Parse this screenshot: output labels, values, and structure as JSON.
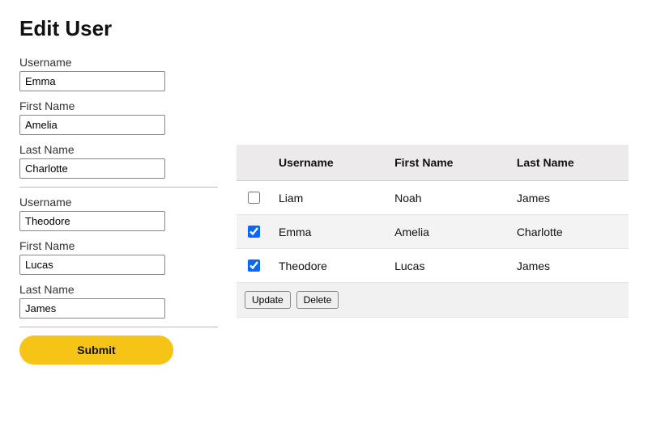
{
  "title": "Edit User",
  "form": {
    "entries": [
      {
        "username_label": "Username",
        "username_value": "Emma",
        "firstname_label": "First Name",
        "firstname_value": "Amelia",
        "lastname_label": "Last Name",
        "lastname_value": "Charlotte"
      },
      {
        "username_label": "Username",
        "username_value": "Theodore",
        "firstname_label": "First Name",
        "firstname_value": "Lucas",
        "lastname_label": "Last Name",
        "lastname_value": "James"
      }
    ],
    "submit_label": "Submit"
  },
  "table": {
    "headers": {
      "username": "Username",
      "firstname": "First Name",
      "lastname": "Last Name"
    },
    "rows": [
      {
        "checked": false,
        "username": "Liam",
        "firstname": "Noah",
        "lastname": "James"
      },
      {
        "checked": true,
        "username": "Emma",
        "firstname": "Amelia",
        "lastname": "Charlotte"
      },
      {
        "checked": true,
        "username": "Theodore",
        "firstname": "Lucas",
        "lastname": "James"
      }
    ],
    "actions": {
      "update": "Update",
      "delete": "Delete"
    }
  }
}
